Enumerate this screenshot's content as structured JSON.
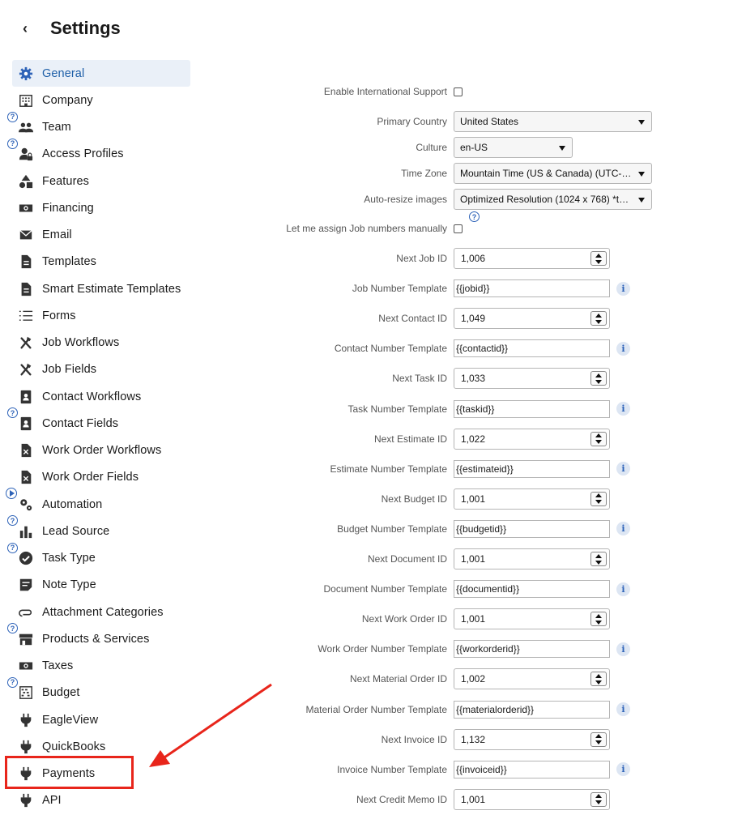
{
  "header": {
    "back_glyph": "‹",
    "title": "Settings"
  },
  "sidebar": {
    "items": [
      {
        "label": "General",
        "icon": "gear-icon",
        "active": true
      },
      {
        "label": "Company",
        "icon": "building-icon"
      },
      {
        "label": "Team",
        "icon": "people-icon",
        "badge": "?"
      },
      {
        "label": "Access Profiles",
        "icon": "user-lock-icon",
        "badge": "?"
      },
      {
        "label": "Features",
        "icon": "shapes-icon"
      },
      {
        "label": "Financing",
        "icon": "money-icon"
      },
      {
        "label": "Email",
        "icon": "envelope-icon"
      },
      {
        "label": "Templates",
        "icon": "document-icon"
      },
      {
        "label": "Smart Estimate Templates",
        "icon": "document-icon"
      },
      {
        "label": "Forms",
        "icon": "list-icon"
      },
      {
        "label": "Job Workflows",
        "icon": "tools-icon"
      },
      {
        "label": "Job Fields",
        "icon": "tools-icon"
      },
      {
        "label": "Contact Workflows",
        "icon": "contact-card-icon"
      },
      {
        "label": "Contact Fields",
        "icon": "contact-card-icon",
        "badge": "?"
      },
      {
        "label": "Work Order Workflows",
        "icon": "work-order-icon"
      },
      {
        "label": "Work Order Fields",
        "icon": "work-order-icon"
      },
      {
        "label": "Automation",
        "icon": "gears-icon",
        "badge": "play"
      },
      {
        "label": "Lead Source",
        "icon": "bar-chart-icon",
        "badge": "?"
      },
      {
        "label": "Task Type",
        "icon": "check-circle-icon",
        "badge": "?"
      },
      {
        "label": "Note Type",
        "icon": "note-icon"
      },
      {
        "label": "Attachment Categories",
        "icon": "paperclip-icon"
      },
      {
        "label": "Products & Services",
        "icon": "store-icon",
        "badge": "?"
      },
      {
        "label": "Taxes",
        "icon": "money-icon"
      },
      {
        "label": "Budget",
        "icon": "abacus-icon",
        "badge": "?"
      },
      {
        "label": "EagleView",
        "icon": "plug-icon"
      },
      {
        "label": "QuickBooks",
        "icon": "plug-icon"
      },
      {
        "label": "Payments",
        "icon": "plug-icon"
      },
      {
        "label": "API",
        "icon": "plug-icon"
      }
    ]
  },
  "form": {
    "intl": {
      "label": "Enable International Support"
    },
    "country": {
      "label": "Primary Country",
      "value": "United States"
    },
    "culture": {
      "label": "Culture",
      "value": "en-US"
    },
    "timezone": {
      "label": "Time Zone",
      "value": "Mountain Time (US & Canada) (UTC-…"
    },
    "resize": {
      "label": "Auto-resize images",
      "value": "Optimized Resolution (1024 x 768) *th…"
    },
    "manual_job": {
      "label": "Let me assign Job numbers manually",
      "help": "?"
    },
    "fields": [
      {
        "label": "Next Job ID",
        "type": "number",
        "value": "1,006"
      },
      {
        "label": "Job Number Template",
        "type": "text",
        "value": "{{jobid}}"
      },
      {
        "label": "Next Contact ID",
        "type": "number",
        "value": "1,049"
      },
      {
        "label": "Contact Number Template",
        "type": "text",
        "value": "{{contactid}}"
      },
      {
        "label": "Next Task ID",
        "type": "number",
        "value": "1,033"
      },
      {
        "label": "Task Number Template",
        "type": "text",
        "value": "{{taskid}}"
      },
      {
        "label": "Next Estimate ID",
        "type": "number",
        "value": "1,022"
      },
      {
        "label": "Estimate Number Template",
        "type": "text",
        "value": "{{estimateid}}"
      },
      {
        "label": "Next Budget ID",
        "type": "number",
        "value": "1,001"
      },
      {
        "label": "Budget Number Template",
        "type": "text",
        "value": "{{budgetid}}"
      },
      {
        "label": "Next Document ID",
        "type": "number",
        "value": "1,001"
      },
      {
        "label": "Document Number Template",
        "type": "text",
        "value": "{{documentid}}"
      },
      {
        "label": "Next Work Order ID",
        "type": "number",
        "value": "1,001"
      },
      {
        "label": "Work Order Number Template",
        "type": "text",
        "value": "{{workorderid}}"
      },
      {
        "label": "Next Material Order ID",
        "type": "number",
        "value": "1,002"
      },
      {
        "label": "Material Order Number Template",
        "type": "text",
        "value": "{{materialorderid}}"
      },
      {
        "label": "Next Invoice ID",
        "type": "number",
        "value": "1,132"
      },
      {
        "label": "Invoice Number Template",
        "type": "text",
        "value": "{{invoiceid}}"
      },
      {
        "label": "Next Credit Memo ID",
        "type": "number",
        "value": "1,001"
      }
    ],
    "info_glyph": "i"
  },
  "colors": {
    "accent": "#1e5fa8",
    "highlight": "#e8251b",
    "active_bg": "#eaf0f8"
  }
}
